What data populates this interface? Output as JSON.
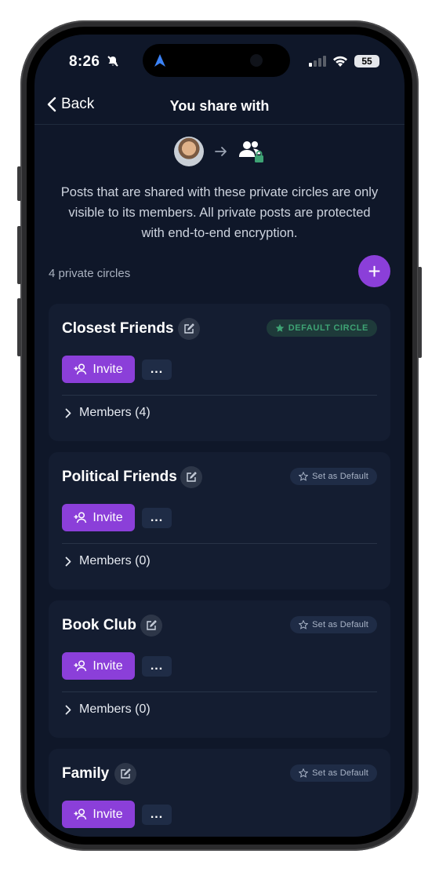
{
  "status_bar": {
    "time": "8:26",
    "battery": "55"
  },
  "nav": {
    "back_label": "Back",
    "title": "You share with"
  },
  "description": "Posts that are shared with these private circles are only visible to its members. All private posts are protected with end-to-end encryption.",
  "circles_count": "4 private circles",
  "add_button": "+",
  "invite_label": "Invite",
  "more_label": "...",
  "circles": [
    {
      "name": "Closest Friends",
      "badge": "DEFAULT CIRCLE",
      "members": "Members (4)"
    },
    {
      "name": "Political Friends",
      "badge": "Set as Default",
      "members": "Members (0)"
    },
    {
      "name": "Book Club",
      "badge": "Set as Default",
      "members": "Members (0)"
    },
    {
      "name": "Family",
      "badge": "Set as Default",
      "members": ""
    }
  ],
  "colors": {
    "accent": "#8b3fd9",
    "background": "#0f1729",
    "card": "#141d31",
    "default_badge": "#3ea374"
  },
  "icons": [
    "back-chevron-icon",
    "arrow-right-icon",
    "people-lock-icon",
    "edit-icon",
    "star-icon",
    "add-person-icon",
    "chevron-right-icon",
    "location-icon",
    "silent-bell-icon",
    "signal-icon",
    "wifi-icon"
  ]
}
